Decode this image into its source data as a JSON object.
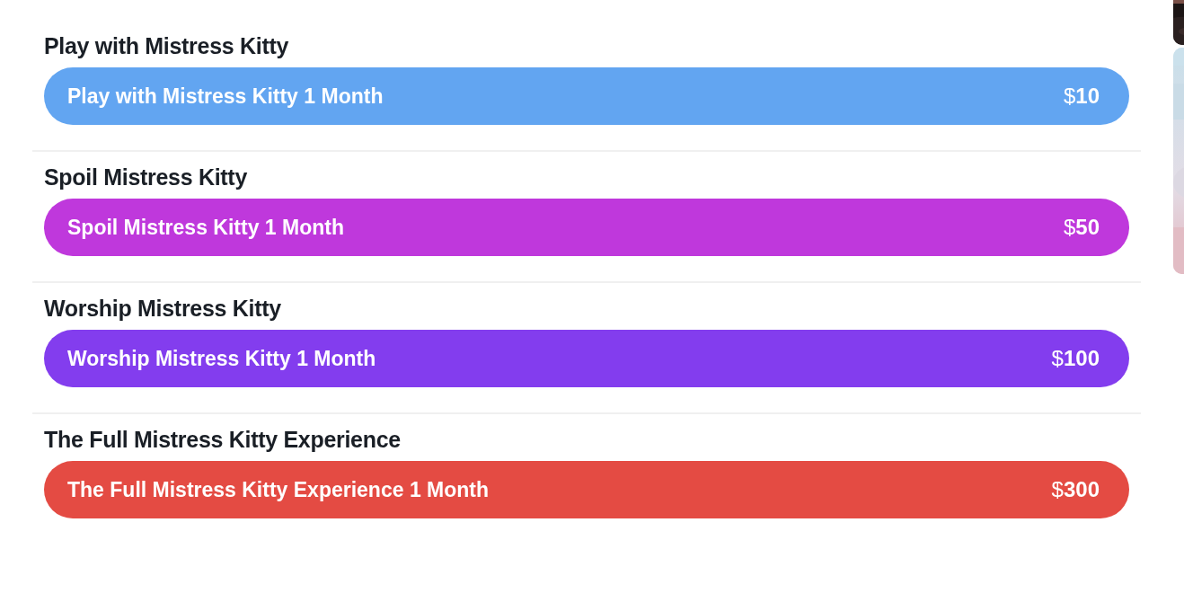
{
  "tiers": [
    {
      "title": "Play with Mistress Kitty",
      "button": "Play with Mistress Kitty 1 Month",
      "price": "$**10**",
      "color": "#62a5f1"
    },
    {
      "title": "Spoil Mistress Kitty",
      "button": "Spoil Mistress Kitty 1 Month",
      "price": "$**50**",
      "color": "#bf38dc"
    },
    {
      "title": "Worship Mistress Kitty",
      "button": "Worship Mistress Kitty 1 Month",
      "price": "$**100**",
      "color": "#833dee"
    },
    {
      "title": "The Full Mistress Kitty Experience",
      "button": "The Full Mistress Kitty Experience 1 Month",
      "price": "$**300**",
      "color": "#e44b43"
    }
  ]
}
